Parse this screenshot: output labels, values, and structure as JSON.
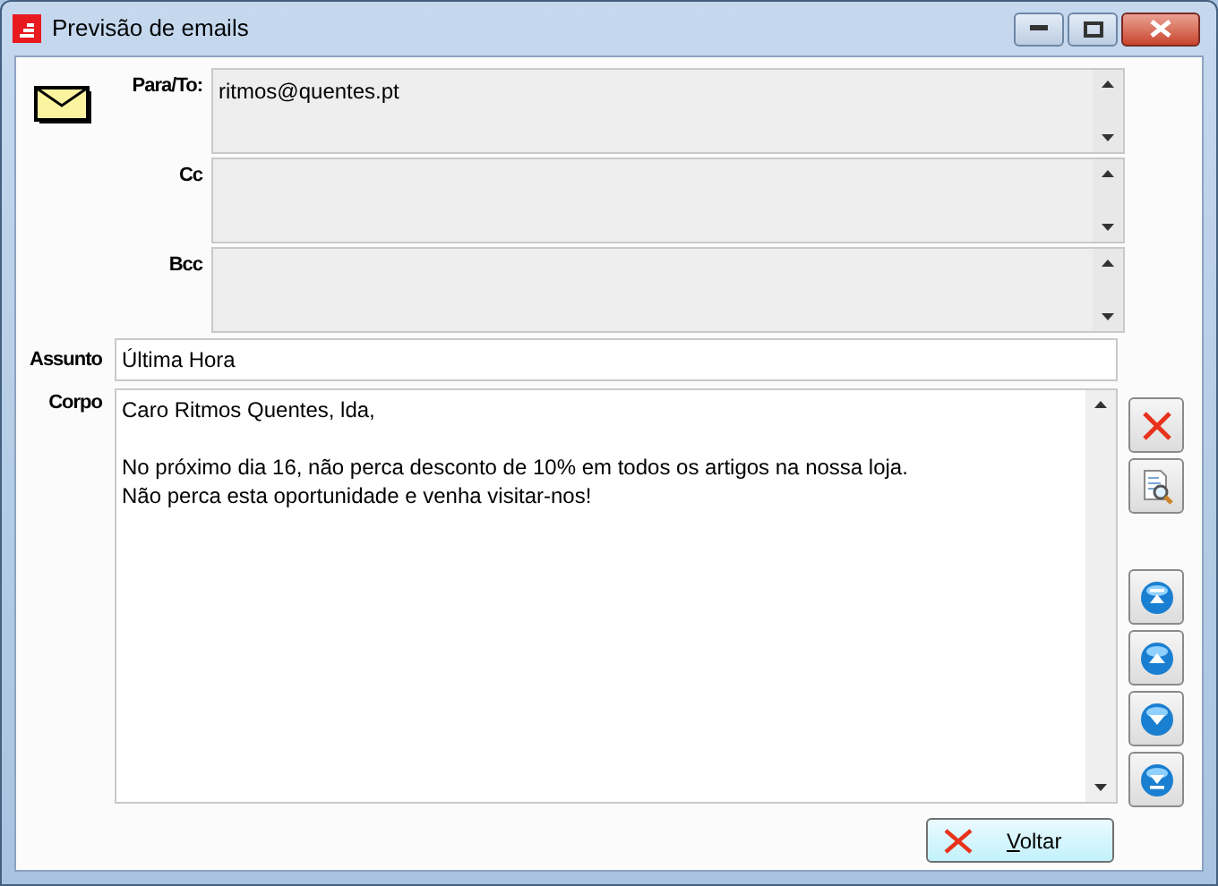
{
  "window": {
    "title": "Previsão de emails"
  },
  "recipients": [
    {
      "label": "Para/To:",
      "value": "ritmos@quentes.pt"
    },
    {
      "label": "Cc"
    },
    {
      "label": "Bcc"
    }
  ],
  "subject": {
    "label": "Assunto",
    "value": "Última Hora"
  },
  "body": {
    "label": "Corpo",
    "value": "Caro Ritmos Quentes, lda,\n\nNo próximo dia 16, não perca desconto de 10% em todos os artigos na nossa loja.\nNão perca esta oportunidade e venha visitar-nos!"
  },
  "side_buttons": [
    {
      "kind": "delete"
    },
    {
      "kind": "preview"
    },
    {
      "kind": "first"
    },
    {
      "kind": "up"
    },
    {
      "kind": "down"
    },
    {
      "kind": "last"
    }
  ],
  "back_button": {
    "label": "Voltar"
  }
}
